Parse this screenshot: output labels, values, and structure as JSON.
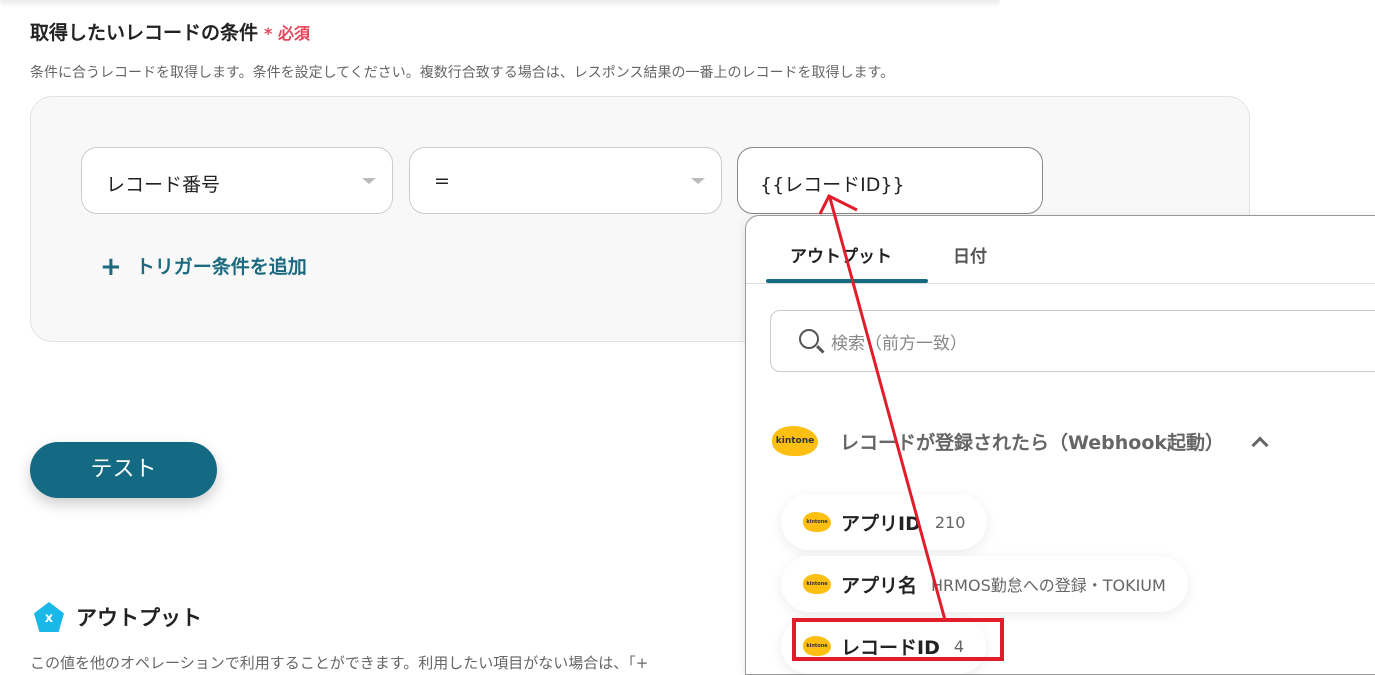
{
  "section": {
    "title": "取得したいレコードの条件",
    "required_mark": "*",
    "required_label": "必須",
    "description": "条件に合うレコードを取得します。条件を設定してください。複数行合致する場合は、レスポンス結果の一番上のレコードを取得します。"
  },
  "condition": {
    "field": "レコード番号",
    "operator": "=",
    "value": "{{レコードID}}",
    "add_label": "トリガー条件を追加"
  },
  "test_button": "テスト",
  "output": {
    "title": "アウトプット",
    "icon_text": "x",
    "description": "この値を他のオペレーションで利用することができます。利用したい項目がない場合は、「+"
  },
  "dropdown": {
    "tabs": [
      {
        "label": "アウトプット",
        "active": true
      },
      {
        "label": "日付",
        "active": false
      }
    ],
    "search_placeholder": "検索（前方一致）",
    "group": {
      "logo": "kintone",
      "title": "レコードが登録されたら（Webhook起動）",
      "expanded": true
    },
    "items": [
      {
        "label": "アプリID",
        "value": "210"
      },
      {
        "label": "アプリ名",
        "value": "HRMOS勤怠への登録・TOKIUM"
      },
      {
        "label": "レコードID",
        "value": "4",
        "highlighted": true
      }
    ]
  },
  "colors": {
    "accent": "#146a82",
    "required": "#e8455a",
    "annotation": "#e31c2a",
    "kintone": "#fdbf11"
  }
}
